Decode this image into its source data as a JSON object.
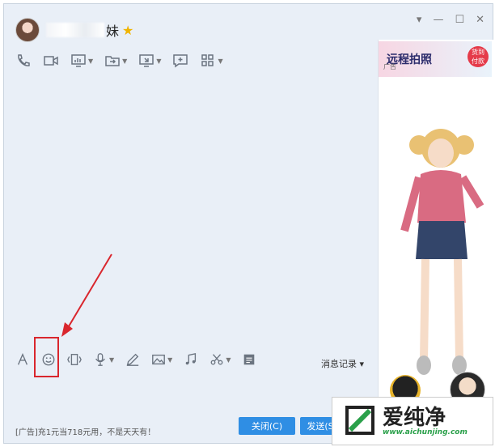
{
  "header": {
    "contact_name_visible": "妹",
    "star_icon": "star-icon"
  },
  "window_controls": {
    "menu": "▾",
    "minimize": "—",
    "maximize": "☐",
    "close": "✕"
  },
  "toolbar_top": {
    "icons": [
      "phone-icon",
      "video-icon",
      "screen-share-icon",
      "file-transfer-icon",
      "remote-desktop-icon",
      "add-chat-icon",
      "apps-grid-icon"
    ]
  },
  "side_ad": {
    "title": "远程拍照",
    "label": "广告",
    "badge": "货到\n付款"
  },
  "toolbar_bottom": {
    "icons": [
      "font-icon",
      "emoji-icon",
      "shake-icon",
      "mic-icon",
      "pen-icon",
      "image-icon",
      "music-icon",
      "scissors-icon",
      "doc-icon"
    ],
    "history_label": "消息记录"
  },
  "footer": {
    "ad_text": "[广告]充1元当718元用，不是天天有！",
    "close_label": "关闭(C)",
    "send_label": "发送(S"
  },
  "watermark": {
    "brand_text": "爱纯净",
    "url": "www.aichunjing.com"
  },
  "annotation": {
    "highlight_color": "#d9262d"
  }
}
